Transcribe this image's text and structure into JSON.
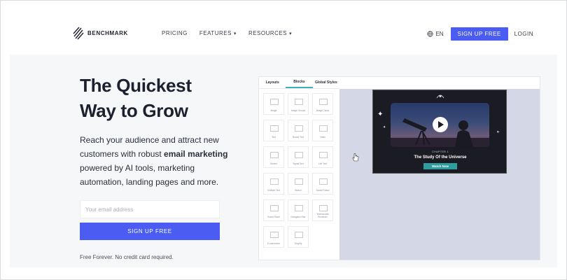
{
  "nav": {
    "brand": "BENCHMARK",
    "links": [
      {
        "label": "PRICING",
        "has_dropdown": false
      },
      {
        "label": "FEATURES",
        "has_dropdown": true
      },
      {
        "label": "RESOURCES",
        "has_dropdown": true
      }
    ],
    "language": "EN",
    "signup_label": "SIGN UP FREE",
    "login_label": "LOGIN"
  },
  "hero": {
    "title_line1": "The Quickest",
    "title_line2": "Way to Grow",
    "lead_part1": "Reach your audience and attract new customers with robust ",
    "lead_bold": "email marketing",
    "lead_part2": " powered by AI tools, marketing automation, landing pages and more.",
    "email_placeholder": "Your email address",
    "signup_label": "SIGN UP FREE",
    "footnote": "Free Forever. No credit card required."
  },
  "editor": {
    "tabs": [
      "Layouts",
      "Blocks",
      "Global Styles"
    ],
    "active_tab": "Blocks",
    "blocks": [
      {
        "label": "Image"
      },
      {
        "label": "Image Groups"
      },
      {
        "label": "Image Carou"
      },
      {
        "label": "Text"
      },
      {
        "label": "Boxed Text"
      },
      {
        "label": "Video"
      },
      {
        "label": "Divider"
      },
      {
        "label": "Signal Text"
      },
      {
        "label": "Left Text"
      },
      {
        "label": "Multiple Text"
      },
      {
        "label": "Button"
      },
      {
        "label": "Social Follow"
      },
      {
        "label": "Social Share"
      },
      {
        "label": "Navigation Bar"
      },
      {
        "label": "Testimonials Reminder"
      },
      {
        "label": "E-commerce"
      },
      {
        "label": "Shopify"
      }
    ],
    "preview": {
      "chapter": "CHAPTER 1",
      "title": "The Study Of the Universe",
      "button": "Watch Now"
    },
    "colors": {
      "accent": "#4a5cf1",
      "teal": "#2f9c9e",
      "canvas": "#d4d7e6"
    }
  }
}
